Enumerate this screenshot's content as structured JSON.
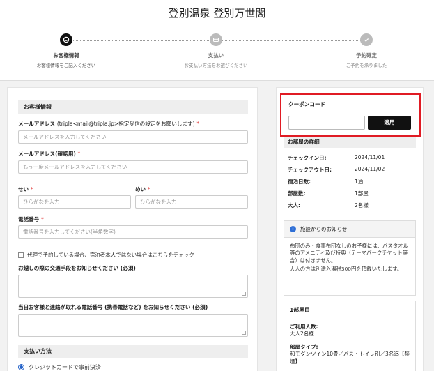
{
  "hotel": {
    "name": "登別温泉 登別万世閣"
  },
  "steps": [
    {
      "label": "お客様情報",
      "sub": "お客様情報をご記入ください"
    },
    {
      "label": "支払い",
      "sub": "お支払い方法をお選びください"
    },
    {
      "label": "予約確定",
      "sub": "ご予約を承りました"
    }
  ],
  "guest": {
    "section_title": "お客様情報",
    "email_label": "メールアドレス",
    "email_note": "(tripla<mail@tripla.jp>指定受信の設定をお願いします)",
    "required_mark": "*",
    "email_placeholder": "メールアドレスを入力してください",
    "email_confirm_label": "メールアドレス(確認用)",
    "email_confirm_placeholder": "もう一度メールアドレスを入力してください",
    "last_name_label": "せい",
    "last_name_placeholder": "ひらがなを入力",
    "first_name_label": "めい",
    "first_name_placeholder": "ひらがなを入力",
    "phone_label": "電話番号",
    "phone_placeholder": "電話番号を入力してください(半角数字)",
    "proxy_checkbox_label": "代理で予約している場合、宿泊者本人ではない場合はこちらをチェック",
    "transport_label": "お越しの際の交通手段をお知らせください (必須)",
    "contact_phone_label": "当日お客様と連絡が取れる電話番号 (携帯電話など) をお知らせください (必須)"
  },
  "payment": {
    "section_title": "支払い方法",
    "option_label": "クレジットカードで事前決済"
  },
  "coupon": {
    "title": "クーポンコード",
    "button_label": "適用",
    "value": ""
  },
  "room_details": {
    "title": "お部屋の詳細",
    "rows": [
      {
        "key": "チェックイン日:",
        "value": "2024/11/01"
      },
      {
        "key": "チェックアウト日:",
        "value": "2024/11/02"
      },
      {
        "key": "宿泊日数:",
        "value": "1泊"
      },
      {
        "key": "部屋数:",
        "value": "1部屋"
      },
      {
        "key": "大人:",
        "value": "2名様"
      }
    ]
  },
  "notice": {
    "title": "施設からのお知らせ",
    "para1": "布団のみ・食事布団なしのお子様には、バスタオル等のアメニティ及び特典（テーマパークチケット等含）は付きません。",
    "para2": "大人の方は別途入湯税300円を頂戴いたします。"
  },
  "room1": {
    "title": "1部屋目",
    "guests_label": "ご利用人数:",
    "guests_value": "大人2名様",
    "type_label": "部屋タイプ:",
    "type_value": "和モダンツイン10畳／バス・トイレ別／3名迄【禁煙】"
  },
  "colors": {
    "accent_red": "#e01b24",
    "radio_blue": "#2563c9",
    "button_black": "#111111"
  }
}
